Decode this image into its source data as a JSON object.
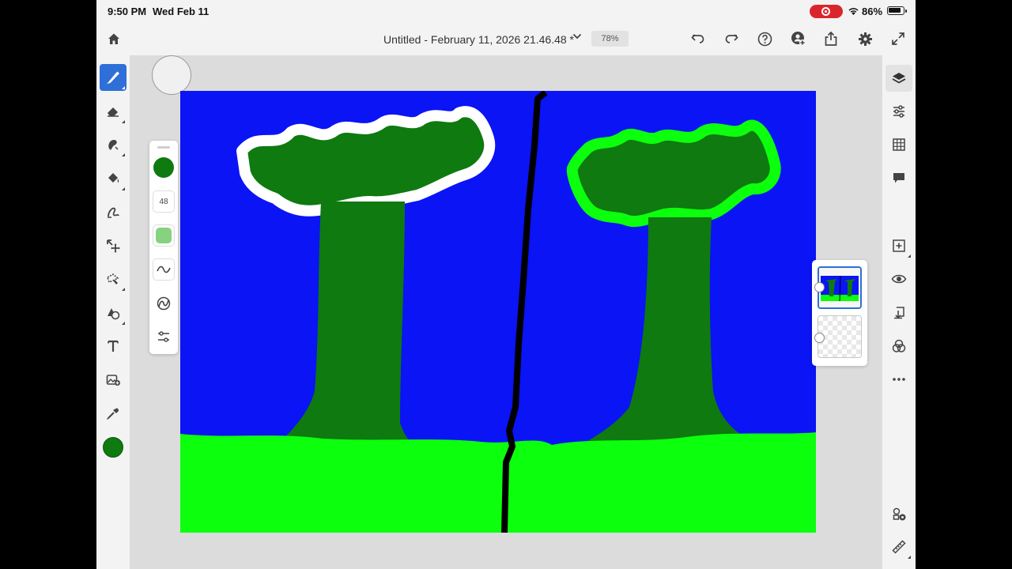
{
  "status_bar": {
    "time": "9:50 PM",
    "date": "Wed Feb 11",
    "battery_percent": "86%"
  },
  "document": {
    "title": "Untitled - February 11, 2026 21.46.48 *",
    "zoom": "78%"
  },
  "top_toolbar": {
    "icons": [
      "home-icon",
      "chevron-down-icon",
      "undo-icon",
      "redo-icon",
      "help-icon",
      "invite-user-icon",
      "share-icon",
      "settings-gear-icon",
      "fullscreen-expand-icon"
    ]
  },
  "left_toolbar": {
    "tools": [
      "paint-brush-icon",
      "eraser-icon",
      "smudge-icon",
      "fill-bucket-icon",
      "liquify-icon",
      "move-transform-icon",
      "lasso-selection-icon",
      "shape-icon",
      "text-icon",
      "image-import-icon",
      "eyedropper-icon"
    ],
    "active_tool": "paint-brush-icon",
    "current_color": "#0e7a10"
  },
  "brush_panel": {
    "size": "48",
    "color": "#0e7a10",
    "opacity_color": "#86d27e"
  },
  "right_toolbar": {
    "tools": [
      "layers-icon",
      "adjustments-icon",
      "grid-icon",
      "comments-icon",
      "add-layer-icon",
      "visibility-eye-icon",
      "merge-down-icon",
      "blend-mode-icon",
      "more-options-icon",
      "properties-icon",
      "ruler-icon"
    ],
    "active_tool": "layers-icon"
  },
  "canvas": {
    "sky_color": "#0a14f4",
    "grass_color": "#0cff0c",
    "tree_color": "#0e7a10",
    "divider_color": "#000000"
  }
}
